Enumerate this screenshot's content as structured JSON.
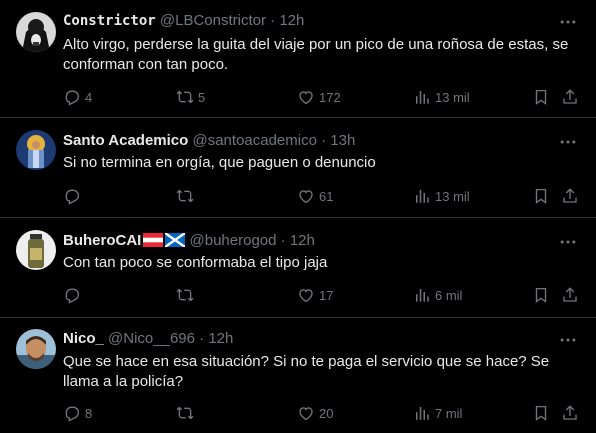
{
  "tweets": [
    {
      "name": "Constrictor",
      "handle": "@LBConstrictor",
      "time": "12h",
      "text": "Alto virgo, perderse la guita del viaje por un pico de una roñosa de estas, se conforman con tan poco.",
      "replies": "4",
      "retweets": "5",
      "likes": "172",
      "views": "13 mil"
    },
    {
      "name": "Santo Academico",
      "handle": "@santoacademico",
      "time": "13h",
      "text": "Si no termina en orgía, que paguen o denuncio",
      "replies": "",
      "retweets": "",
      "likes": "61",
      "views": "13 mil"
    },
    {
      "name": "BuheroCAI",
      "handle": "@buherogod",
      "time": "12h",
      "text": "Con tan poco se conformaba el tipo jaja",
      "replies": "",
      "retweets": "",
      "likes": "17",
      "views": "6 mil"
    },
    {
      "name": "Nico_",
      "handle": "@Nico__696",
      "time": "12h",
      "text": "Que se hace en esa situación? Si no te paga el servicio que se hace? Se llama a la policía?",
      "replies": "8",
      "retweets": "",
      "likes": "20",
      "views": "7 mil"
    }
  ],
  "separator": "·",
  "icons": {
    "reply": "reply-icon",
    "retweet": "retweet-icon",
    "like": "heart-icon",
    "views": "views-icon",
    "bookmark": "bookmark-icon",
    "share": "share-icon",
    "more": "more-icon"
  },
  "colors": {
    "background": "#000000",
    "text": "#e7e9ea",
    "muted": "#71767b",
    "border": "#2f3336"
  }
}
